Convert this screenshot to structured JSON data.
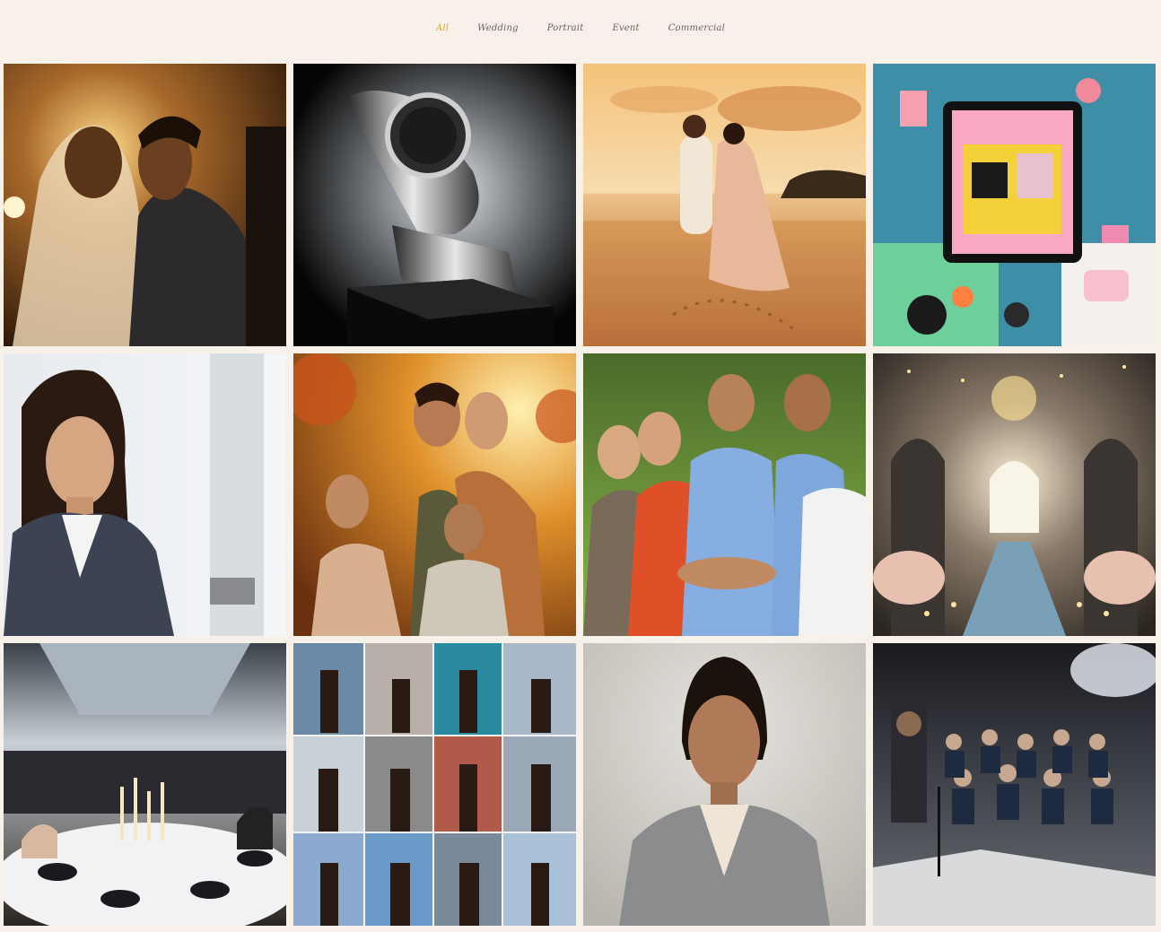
{
  "filters": [
    {
      "label": "All",
      "active": true
    },
    {
      "label": "Wedding",
      "active": false
    },
    {
      "label": "Portrait",
      "active": false
    },
    {
      "label": "Event",
      "active": false
    },
    {
      "label": "Commercial",
      "active": false
    }
  ],
  "colors": {
    "background": "#f8f1ea",
    "accent": "#d4a53a",
    "nav_text": "#6f5f55"
  },
  "gallery": [
    {
      "id": "wedding-couple-golden-light",
      "category": "Wedding"
    },
    {
      "id": "luxury-watch-product",
      "category": "Commercial"
    },
    {
      "id": "beach-sunset-couple",
      "category": "Wedding"
    },
    {
      "id": "flatlay-products",
      "category": "Commercial"
    },
    {
      "id": "businesswoman-portrait",
      "category": "Portrait"
    },
    {
      "id": "family-autumn-portrait",
      "category": "Portrait"
    },
    {
      "id": "team-celebration",
      "category": "Event"
    },
    {
      "id": "wedding-venue-chandelier",
      "category": "Wedding"
    },
    {
      "id": "banquet-hall-dinner",
      "category": "Event"
    },
    {
      "id": "fashion-collage",
      "category": "Portrait"
    },
    {
      "id": "woman-grey-blazer-portrait",
      "category": "Portrait"
    },
    {
      "id": "conference-speaker",
      "category": "Event"
    }
  ]
}
